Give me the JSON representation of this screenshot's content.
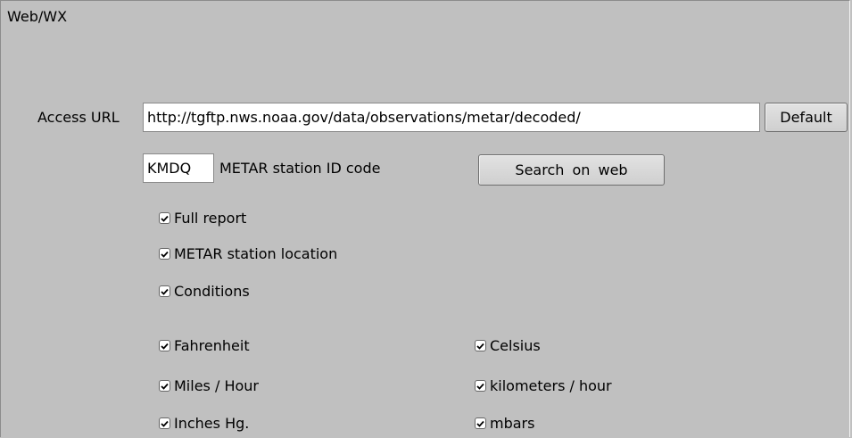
{
  "panel": {
    "title": "Web/WX"
  },
  "access": {
    "label": "Access URL",
    "url_value": "http://tgftp.nws.noaa.gov/data/observations/metar/decoded/",
    "default_button": "Default"
  },
  "station": {
    "id_value": "KMDQ",
    "id_label": "METAR station ID code",
    "search_button": "Search on  web"
  },
  "options": {
    "full_report": {
      "label": "Full report",
      "checked": true
    },
    "station_location": {
      "label": "METAR station location",
      "checked": true
    },
    "conditions": {
      "label": "Conditions",
      "checked": true
    }
  },
  "units": {
    "fahrenheit": {
      "label": "Fahrenheit",
      "checked": true
    },
    "celsius": {
      "label": "Celsius",
      "checked": true
    },
    "mph": {
      "label": "Miles / Hour",
      "checked": true
    },
    "kmh": {
      "label": "kilometers / hour",
      "checked": true
    },
    "inhg": {
      "label": "Inches Hg.",
      "checked": true
    },
    "mbars": {
      "label": "mbars",
      "checked": true
    }
  }
}
